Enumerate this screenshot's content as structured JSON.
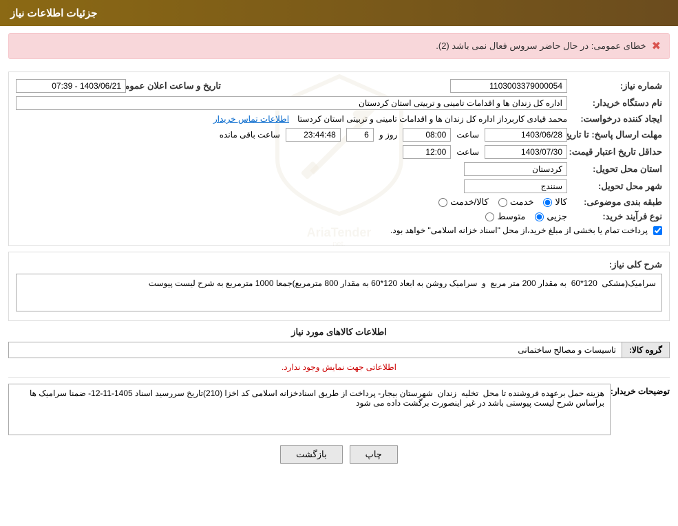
{
  "header": {
    "title": "جزئیات اطلاعات نیاز"
  },
  "error": {
    "message": "خطای عمومی: در حال حاضر سروس فعال نمی باشد (2).",
    "icon": "✖"
  },
  "fields": {
    "need_number_label": "شماره نیاز:",
    "need_number_value": "1103003379000054",
    "date_label": "تاریخ و ساعت اعلان عمومی:",
    "date_value": "1403/06/21 - 07:39",
    "buyer_org_label": "نام دستگاه خریدار:",
    "buyer_org_value": "اداره کل زندان ها و اقدامات تامینی و تربیتی استان کردستان",
    "creator_label": "ایجاد کننده درخواست:",
    "creator_value": "محمد  قیادی کاربرداز اداره کل زندان ها و اقدامات تامینی و تربیتی استان کردستا",
    "contact_link": "اطلاعات تماس خریدار",
    "deadline_label": "مهلت ارسال پاسخ: تا تاریخ:",
    "deadline_date": "1403/06/28",
    "deadline_time": "08:00",
    "deadline_remaining": "6",
    "deadline_remaining_unit": "روز و",
    "deadline_clock": "23:44:48",
    "deadline_clock_label": "ساعت باقی مانده",
    "validity_label": "حداقل تاریخ اعتبار قیمت: تا تاریخ:",
    "validity_date": "1403/07/30",
    "validity_time": "12:00",
    "delivery_province_label": "استان محل تحویل:",
    "delivery_province_value": "کردستان",
    "delivery_city_label": "شهر محل تحویل:",
    "delivery_city_value": "سنندج",
    "category_label": "طبقه بندی موضوعی:",
    "category_options": [
      "کالا",
      "خدمت",
      "کالا/خدمت"
    ],
    "category_selected": "کالا",
    "process_label": "نوع فرآیند خرید:",
    "process_options": [
      "جزیی",
      "متوسط"
    ],
    "process_selected": "جزیی",
    "payment_checkbox_label": "پرداخت تمام یا بخشی از مبلغ خرید،از محل \"اسناد خزانه اسلامی\" خواهد بود.",
    "payment_checked": true,
    "description_label": "شرح کلی نیاز:",
    "description_value": "سرامیک(مشکی  120*60  به مقدار 200 متر مربع  و  سرامیک روشن به ابعاد 120*60 به مقدار 800 مترمربع)جمعا 1000 مترمربع به شرح لیست پیوست",
    "goods_section_title": "اطلاعات کالاهای مورد نیاز",
    "goods_group_label": "گروه کالا:",
    "goods_group_value": "تاسیسات و مصالح ساختمانی",
    "goods_note": "اطلاعاتی جهت نمایش وجود ندارد.",
    "buyer_desc_label": "توضیحات خریدار:",
    "buyer_desc_value": "هزینه حمل برعهده فروشنده تا محل  تخلیه  زندان  شهرستان بیجار- پرداخت از طریق اسنادخزانه اسلامی کد اخزا (210)تاریخ سررسید اسناد 1405-11-12- ضمنا سرامیک ها براساس شرح لیست پیوستی باشد در غیر اینصورت برگشت داده می شود"
  },
  "buttons": {
    "print_label": "چاپ",
    "back_label": "بازگشت"
  }
}
